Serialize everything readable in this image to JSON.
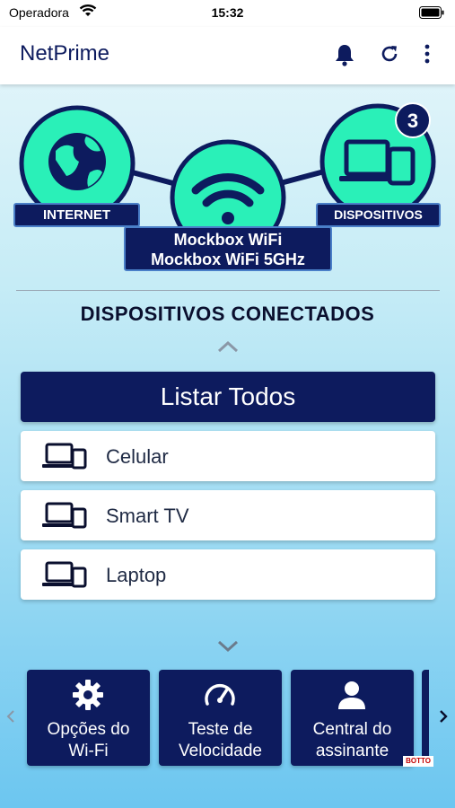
{
  "status_bar": {
    "carrier": "Operadora",
    "time": "15:32"
  },
  "app_bar": {
    "title": "NetPrime"
  },
  "network": {
    "internet_label": "INTERNET",
    "devices_label": "DISPOSITIVOS",
    "wifi_names": [
      "Mockbox WiFi",
      "Mockbox WiFi 5GHz"
    ],
    "device_count": "3"
  },
  "section": {
    "title": "DISPOSITIVOS CONECTADOS"
  },
  "list_all_label": "Listar Todos",
  "devices": [
    {
      "name": "Celular"
    },
    {
      "name": "Smart TV"
    },
    {
      "name": "Laptop"
    }
  ],
  "tiles": [
    {
      "line1": "Opções do",
      "line2": "Wi-Fi",
      "icon": "gear-icon"
    },
    {
      "line1": "Teste de",
      "line2": "Velocidade",
      "icon": "speedometer-icon"
    },
    {
      "line1": "Central do",
      "line2": "assinante",
      "icon": "person-icon"
    }
  ],
  "watermark": "BOTTO",
  "colors": {
    "navy": "#0d1b5e",
    "accent_green": "#2af0b8"
  }
}
